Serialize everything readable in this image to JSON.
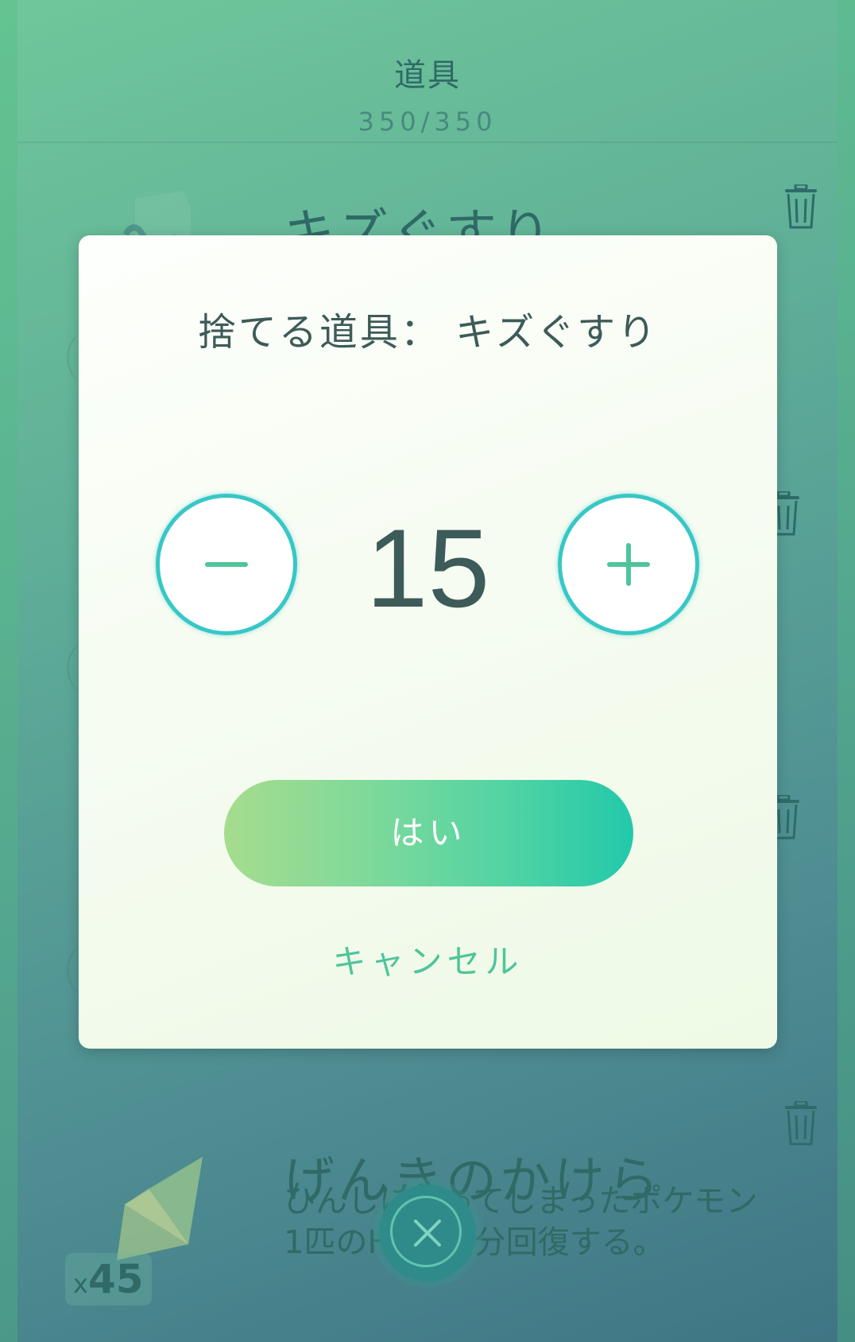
{
  "header": {
    "title": "道具",
    "count": "350/350"
  },
  "list": {
    "items": [
      {
        "name": "キズぐすり"
      },
      {
        "name": "げんきのかけら",
        "description_line1": "ひんしになってしまったポケモン",
        "description_line2": "1匹のHPを半分回復する。",
        "count_prefix": "x",
        "count": "45"
      }
    ]
  },
  "dialog": {
    "title": "捨てる道具： キズぐすり",
    "quantity": "15",
    "confirm_label": "はい",
    "cancel_label": "キャンセル"
  },
  "icons": {
    "decrease": "minus-icon",
    "increase": "plus-icon",
    "trash": "trash-icon",
    "close": "close-icon"
  },
  "colors": {
    "accent_teal": "#37c7c6",
    "accent_green": "#4fc49a",
    "button_gradient_start": "#a6dc8e",
    "button_gradient_end": "#22c9aa",
    "text_dark": "#3d5b58"
  }
}
